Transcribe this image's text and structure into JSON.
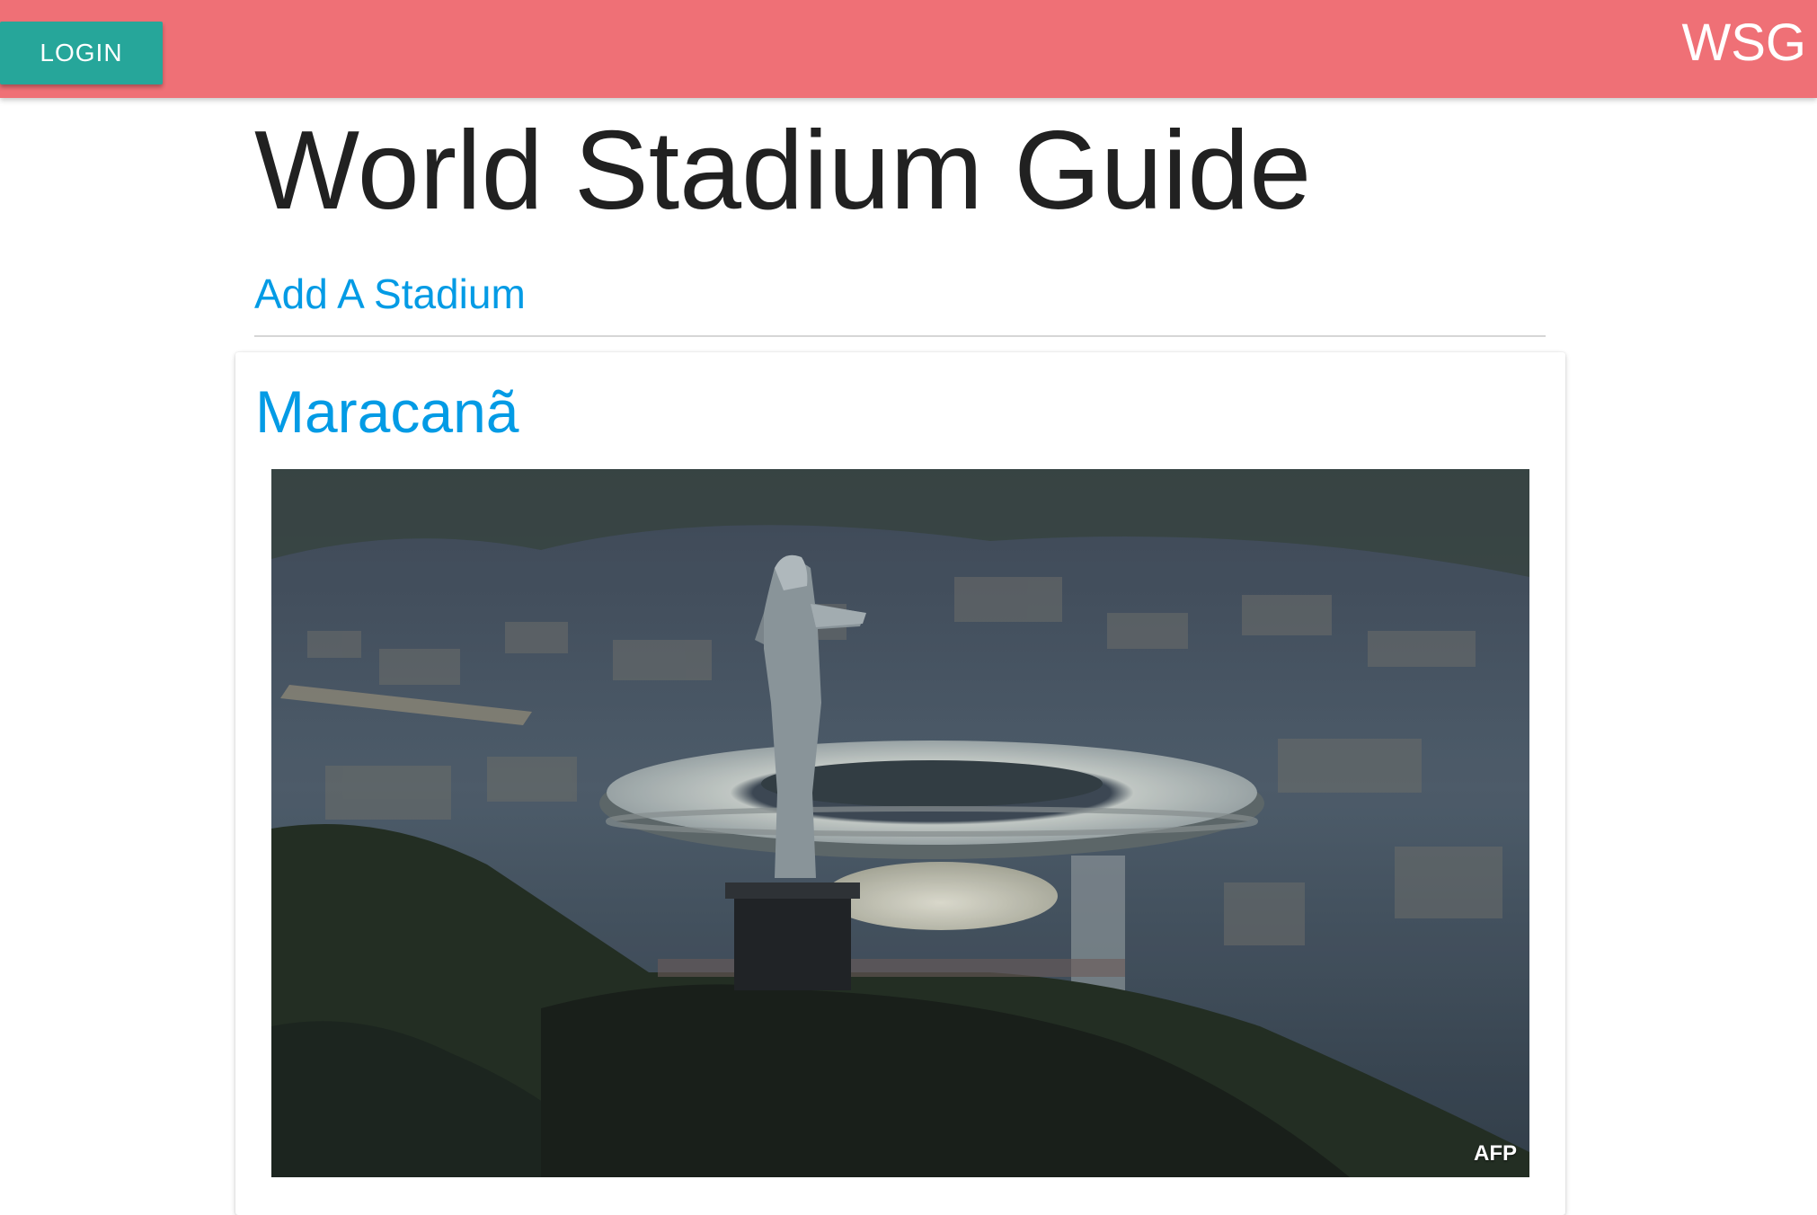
{
  "navbar": {
    "login_label": "LOGIN",
    "brand": "WSG",
    "color": "#ef7076",
    "login_color": "#26a69a"
  },
  "main": {
    "title": "World Stadium Guide",
    "add_link": "Add A Stadium",
    "link_color": "#039be5"
  },
  "stadiums": [
    {
      "name": "Maracanã",
      "image_credit": "AFP"
    }
  ]
}
